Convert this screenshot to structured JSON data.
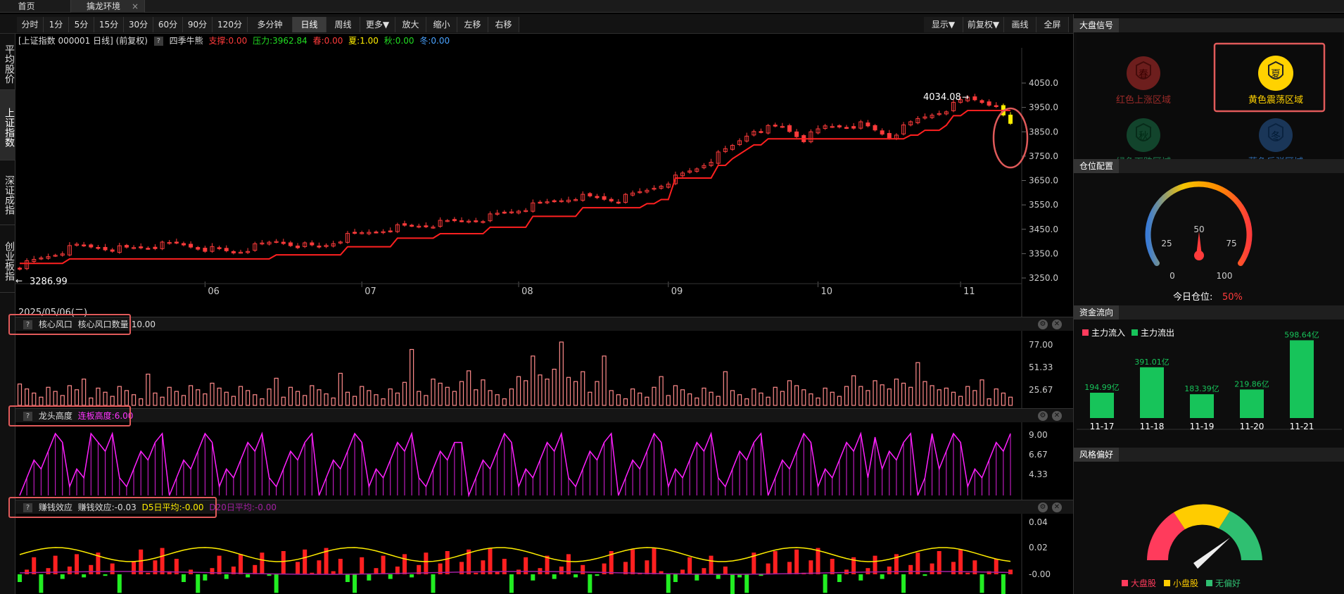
{
  "tabs": {
    "home": "首页",
    "active": "擒龙环境",
    "close": "×"
  },
  "toolbar": {
    "periods": [
      "分时",
      "1分",
      "5分",
      "15分",
      "30分",
      "60分",
      "90分",
      "120分",
      "多分钟",
      "日线",
      "周线",
      "更多▼",
      "放大",
      "缩小",
      "左移",
      "右移"
    ],
    "active_period": "日线",
    "right": [
      "显示▼",
      "前复权▼",
      "画线",
      "全屏"
    ]
  },
  "left_nav": [
    "平均股价",
    "上证指数",
    "深证成指",
    "创业板指"
  ],
  "left_nav_active": 1,
  "main_chart": {
    "info_prefix": "[上证指数 000001 日线] (前复权)",
    "indicator": "四季牛熊",
    "items": [
      {
        "label": "支撑:0.00",
        "color": "#ff3b3b"
      },
      {
        "label": "压力:3962.84",
        "color": "#22dd22"
      },
      {
        "label": "春:0.00",
        "color": "#ff3b3b"
      },
      {
        "label": "夏:1.00",
        "color": "#ffee00"
      },
      {
        "label": "秋:0.00",
        "color": "#22dd22"
      },
      {
        "label": "冬:0.00",
        "color": "#4aa3ff"
      }
    ],
    "y_ticks": [
      "4050.0",
      "3950.0",
      "3850.0",
      "3750.0",
      "3650.0",
      "3550.0",
      "3450.0",
      "3350.0",
      "3250.0"
    ],
    "high_label": "4034.08",
    "low_label": "3286.99",
    "date_label": "2025/05/06(二)",
    "month_labels": [
      "06",
      "07",
      "08",
      "09",
      "10",
      "11"
    ]
  },
  "panels": {
    "core": {
      "name": "核心风口",
      "value_text": "核心风口数量:10.00",
      "y_ticks": [
        "77.00",
        "51.33",
        "25.67"
      ]
    },
    "dragon": {
      "name": "龙头高度",
      "value_text": "连板高度:6.00",
      "y_ticks": [
        "9.00",
        "6.67",
        "4.33"
      ]
    },
    "money": {
      "name": "赚钱效应",
      "value_text": "赚钱效应:-0.03",
      "d5": "D5日平均:-0.00",
      "d20": "D20日平均:-0.00",
      "y_ticks": [
        "0.04",
        "0.02",
        "-0.00"
      ]
    }
  },
  "right_panel": {
    "market_signal": {
      "title": "大盘信号",
      "items": [
        {
          "glyph": "春",
          "label": "红色上涨区域",
          "color": "#c0302d",
          "active": false
        },
        {
          "glyph": "夏",
          "label": "黄色震荡区域",
          "color": "#ffd200",
          "active": true
        },
        {
          "glyph": "秋",
          "label": "绿色下跌区域",
          "color": "#1b8a55",
          "active": false
        },
        {
          "glyph": "冬",
          "label": "蓝色反弹区域",
          "color": "#2d6bb5",
          "active": false
        }
      ]
    },
    "position": {
      "title": "仓位配置",
      "ticks": [
        "0",
        "25",
        "50",
        "75",
        "100"
      ],
      "label": "今日仓位:",
      "value": "50%",
      "level": 0.5
    },
    "flow": {
      "title": "资金流向",
      "legend_in": "主力流入",
      "legend_out": "主力流出",
      "unit": "亿",
      "dates": [
        "11-17",
        "11-18",
        "11-19",
        "11-20",
        "11-21"
      ],
      "values": [
        194.99,
        391.01,
        183.39,
        219.86,
        598.64
      ],
      "labels": [
        "194.99亿",
        "391.01亿",
        "183.39亿",
        "219.86亿",
        "598.64亿"
      ]
    },
    "style": {
      "title": "风格偏好",
      "legend": [
        "大盘股",
        "小盘股",
        "无偏好"
      ],
      "colors": [
        "#ff3b5c",
        "#ffcc00",
        "#2fbf71"
      ]
    }
  }
}
